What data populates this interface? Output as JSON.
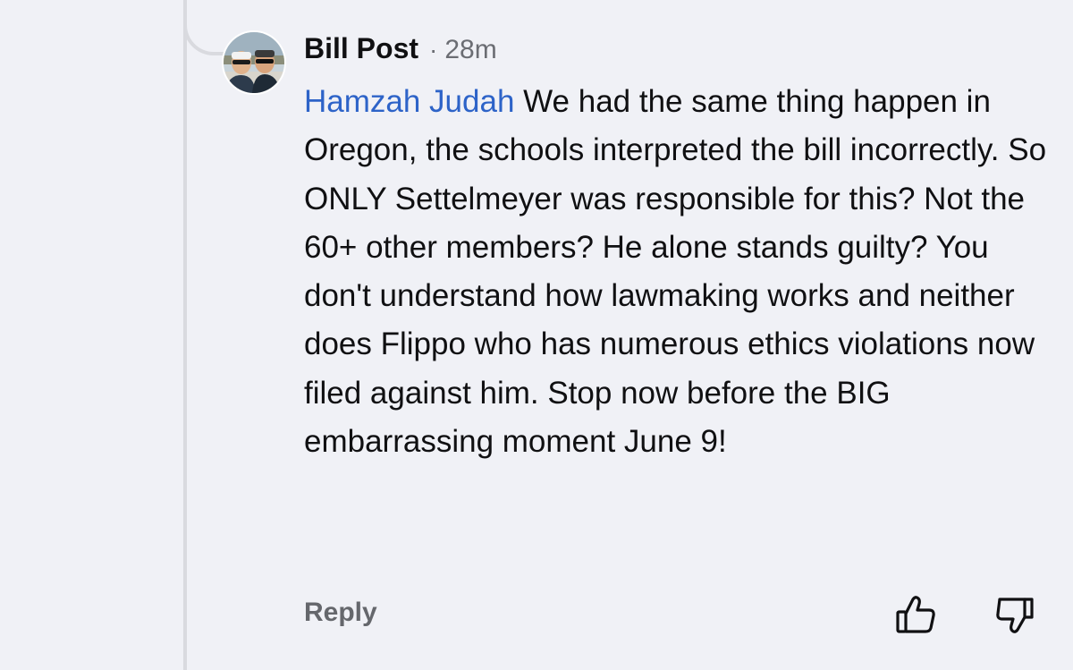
{
  "comment": {
    "author": "Bill Post",
    "separator": "·",
    "time": "28m",
    "mention": "Hamzah Judah",
    "text": " We had the same thing happen in Oregon, the schools interpreted the bill incorrectly. So ONLY Settelmeyer was responsible for this? Not the 60+ other members? He alone stands guilty? You don't understand how lawmaking works and neither does Flippo who has numerous ethics violations now filed against him. Stop now before the BIG embarrassing moment June 9!"
  },
  "actions": {
    "reply_label": "Reply",
    "like_icon": "thumbs-up-icon",
    "dislike_icon": "thumbs-down-icon"
  },
  "colors": {
    "background": "#f0f1f6",
    "mention": "#2d63c8",
    "muted_text": "#6b6d73",
    "thread_line": "#d9dadf"
  }
}
